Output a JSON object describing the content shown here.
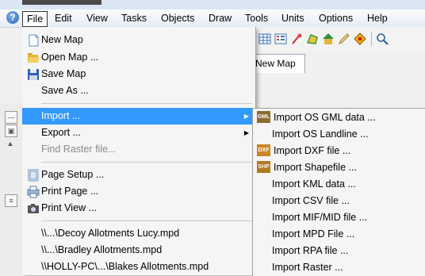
{
  "menubar": {
    "items": [
      "File",
      "Edit",
      "View",
      "Tasks",
      "Objects",
      "Draw",
      "Tools",
      "Units",
      "Options",
      "Help"
    ],
    "help_glyph": "?"
  },
  "tab": {
    "label": "New Map"
  },
  "file_menu": {
    "items": [
      {
        "label": "New Map",
        "icon": "new-map-icon"
      },
      {
        "label": "Open Map ...",
        "icon": "open-folder-icon"
      },
      {
        "label": "Save Map",
        "icon": "save-disk-icon"
      },
      {
        "label": "Save As ...",
        "icon": ""
      },
      {
        "label": "Import ...",
        "icon": "",
        "submenu": true,
        "highlighted": true
      },
      {
        "label": "Export ...",
        "icon": "",
        "submenu": true
      },
      {
        "label": "Find Raster file...",
        "icon": "",
        "disabled": true
      },
      {
        "label": "Page Setup ...",
        "icon": "page-setup-icon"
      },
      {
        "label": "Print Page ...",
        "icon": "print-page-icon"
      },
      {
        "label": "Print View ...",
        "icon": "camera-icon"
      },
      {
        "label": "\\\\...\\Decoy Allotments Lucy.mpd",
        "icon": ""
      },
      {
        "label": "\\\\...\\Bradley Allotments.mpd",
        "icon": ""
      },
      {
        "label": "\\\\HOLLY-PC\\...\\Blakes Allotments.mpd",
        "icon": ""
      }
    ],
    "arrow_glyph": "▶"
  },
  "import_submenu": {
    "items": [
      {
        "label": "Import OS GML data ...",
        "icon": "gml-icon",
        "icon_text": "GML"
      },
      {
        "label": "Import OS Landline ...",
        "icon": ""
      },
      {
        "label": "Import DXF file ...",
        "icon": "dxf-icon",
        "icon_text": "DXF"
      },
      {
        "label": "Import Shapefile ...",
        "icon": "shp-icon",
        "icon_text": "SHP"
      },
      {
        "label": "Import KML data ...",
        "icon": ""
      },
      {
        "label": "Import CSV file ...",
        "icon": ""
      },
      {
        "label": "Import MIF/MID file ...",
        "icon": ""
      },
      {
        "label": "Import MPD File ...",
        "icon": ""
      },
      {
        "label": "Import RPA file ...",
        "icon": ""
      },
      {
        "label": "Import Raster ...",
        "icon": ""
      }
    ]
  },
  "colors": {
    "highlight": "#3399ff",
    "menu_bg": "#f5f5f5",
    "disabled_text": "#8a8a8a"
  }
}
